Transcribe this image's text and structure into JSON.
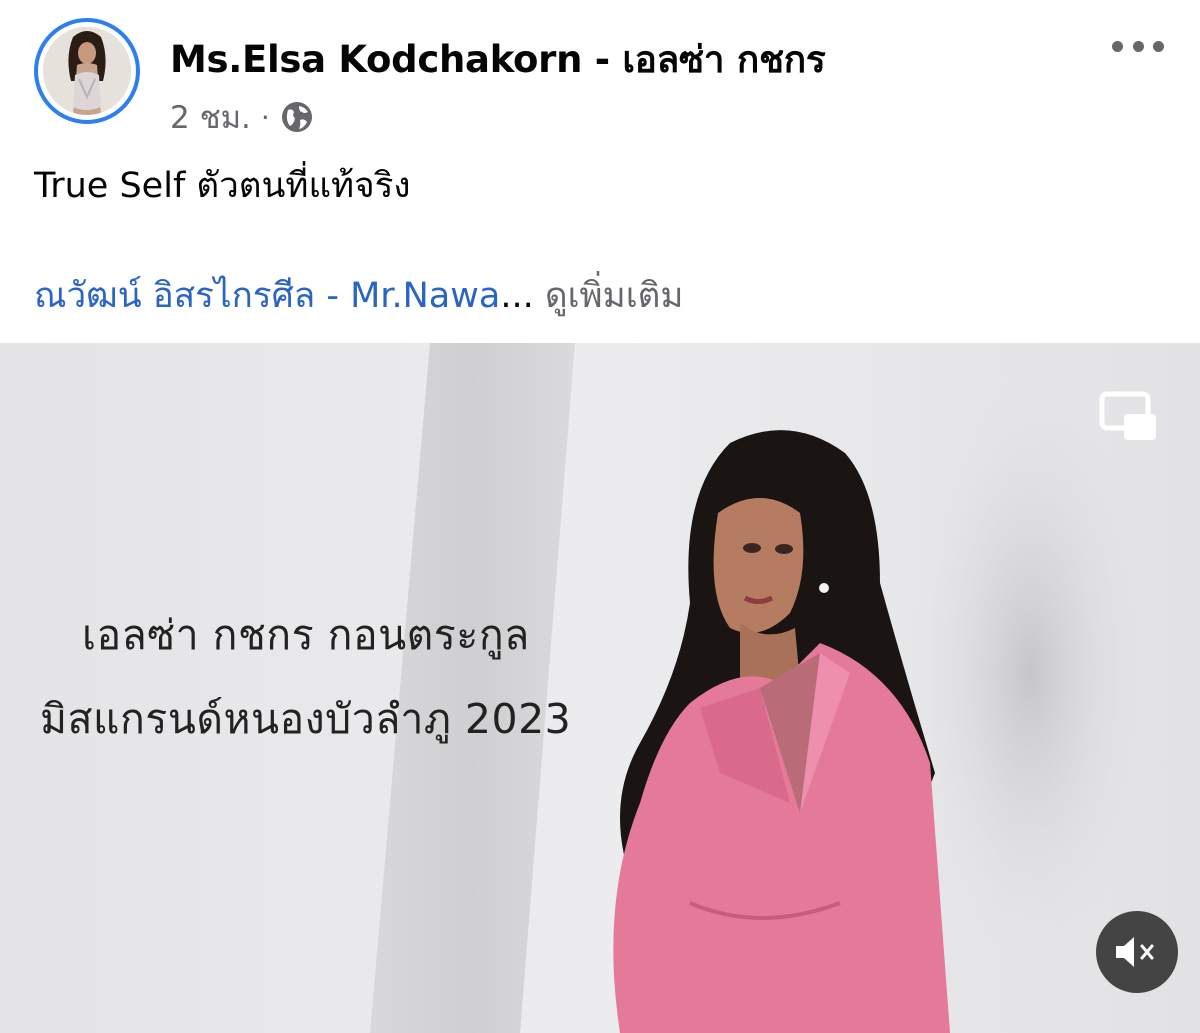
{
  "post": {
    "author_name": "Ms.Elsa Kodchakorn - เอลซ่า กชกร",
    "timestamp": "2 ชม.",
    "separator": "·",
    "privacy_icon": "globe-icon",
    "text": "True Self ตัวตนที่แท้จริง",
    "tag_link": "ณวัฒน์ อิสรไกรศีล - Mr.Nawa",
    "ellipsis": "...",
    "see_more": "ดูเพิ่มเติม",
    "more_icon": "more-options-icon"
  },
  "video": {
    "caption_line1": "เอลซ่า กชกร กอนตระกูล",
    "caption_line2": "มิสแกรนด์หนองบัวลำภู 2023",
    "pip_icon": "picture-in-picture-icon",
    "mute_icon": "speaker-muted-icon"
  },
  "colors": {
    "link": "#2a64c5",
    "avatar_ring": "#2d7ff0",
    "meta_text": "#65676b",
    "jacket": "#e4799a"
  }
}
